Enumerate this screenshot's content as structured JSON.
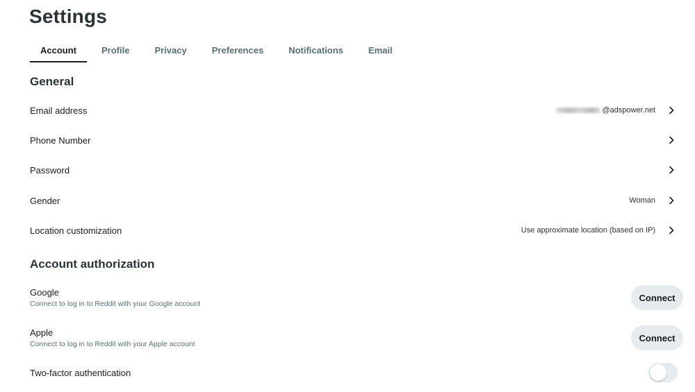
{
  "page_title": "Settings",
  "tabs": [
    {
      "label": "Account",
      "active": true
    },
    {
      "label": "Profile",
      "active": false
    },
    {
      "label": "Privacy",
      "active": false
    },
    {
      "label": "Preferences",
      "active": false
    },
    {
      "label": "Notifications",
      "active": false
    },
    {
      "label": "Email",
      "active": false
    }
  ],
  "general": {
    "heading": "General",
    "rows": [
      {
        "label": "Email address",
        "value": "@adspower.net",
        "value_redacted_prefix": true,
        "icon": "chevron-right-icon"
      },
      {
        "label": "Phone Number",
        "value": "",
        "icon": "chevron-right-icon"
      },
      {
        "label": "Password",
        "value": "",
        "icon": "chevron-right-icon"
      },
      {
        "label": "Gender",
        "value": "Woman",
        "icon": "chevron-right-icon"
      },
      {
        "label": "Location customization",
        "value": "Use approximate location (based on IP)",
        "icon": "chevron-right-icon"
      }
    ]
  },
  "account_authorization": {
    "heading": "Account authorization",
    "google": {
      "title": "Google",
      "subtitle": "Connect to log in to Reddit with your Google account",
      "button": "Connect"
    },
    "apple": {
      "title": "Apple",
      "subtitle": "Connect to log in to Reddit with your Apple account",
      "button": "Connect"
    },
    "two_factor": {
      "label": "Two-factor authentication",
      "enabled": false
    }
  },
  "colors": {
    "heading": "#2a3236",
    "tab_inactive": "#576f76",
    "button_bg": "#e5ebee",
    "toggle_off": "#e5ebee"
  }
}
